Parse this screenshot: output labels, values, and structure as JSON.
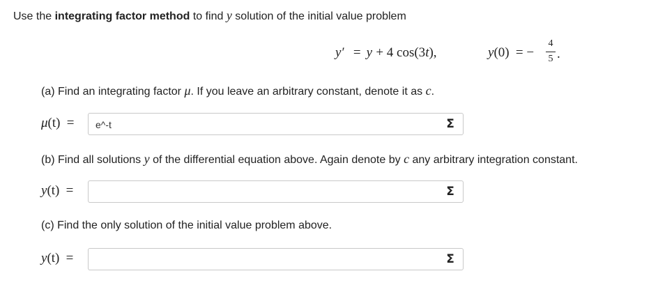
{
  "intro": {
    "prefix": "Use the ",
    "bold": "integrating factor method",
    "mid": " to find ",
    "var": "y",
    "suffix": " solution of the initial value problem"
  },
  "equation": {
    "lhs": "y′",
    "eq": "=",
    "rhs_var": "y",
    "rhs_rest": "+ 4 cos(3",
    "rhs_t": "t",
    "rhs_close": "),",
    "ic_lhs_y": "y",
    "ic_lhs_arg": "(0)",
    "ic_eq": "= −",
    "ic_num": "4",
    "ic_den": "5",
    "ic_dot": "."
  },
  "part_a": {
    "text_before": "(a) Find an integrating factor ",
    "symbol": "μ",
    "text_after": ". If you leave an arbitrary constant, denote it as ",
    "const": "c",
    "period": ".",
    "label_fn": "μ",
    "label_arg": "(t)",
    "label_eq": "=",
    "input_value": "e^-t"
  },
  "part_b": {
    "text_before": "(b) Find all solutions ",
    "var": "y",
    "text_mid": " of the differential equation above. Again denote by ",
    "const": "c",
    "text_after": " any arbitrary integration constant.",
    "label_fn": "y",
    "label_arg": "(t)",
    "label_eq": "=",
    "input_value": ""
  },
  "part_c": {
    "text": "(c) Find the only solution of the initial value problem above.",
    "label_fn": "y",
    "label_arg": "(t)",
    "label_eq": "=",
    "input_value": ""
  },
  "sigma_symbol": "Σ"
}
